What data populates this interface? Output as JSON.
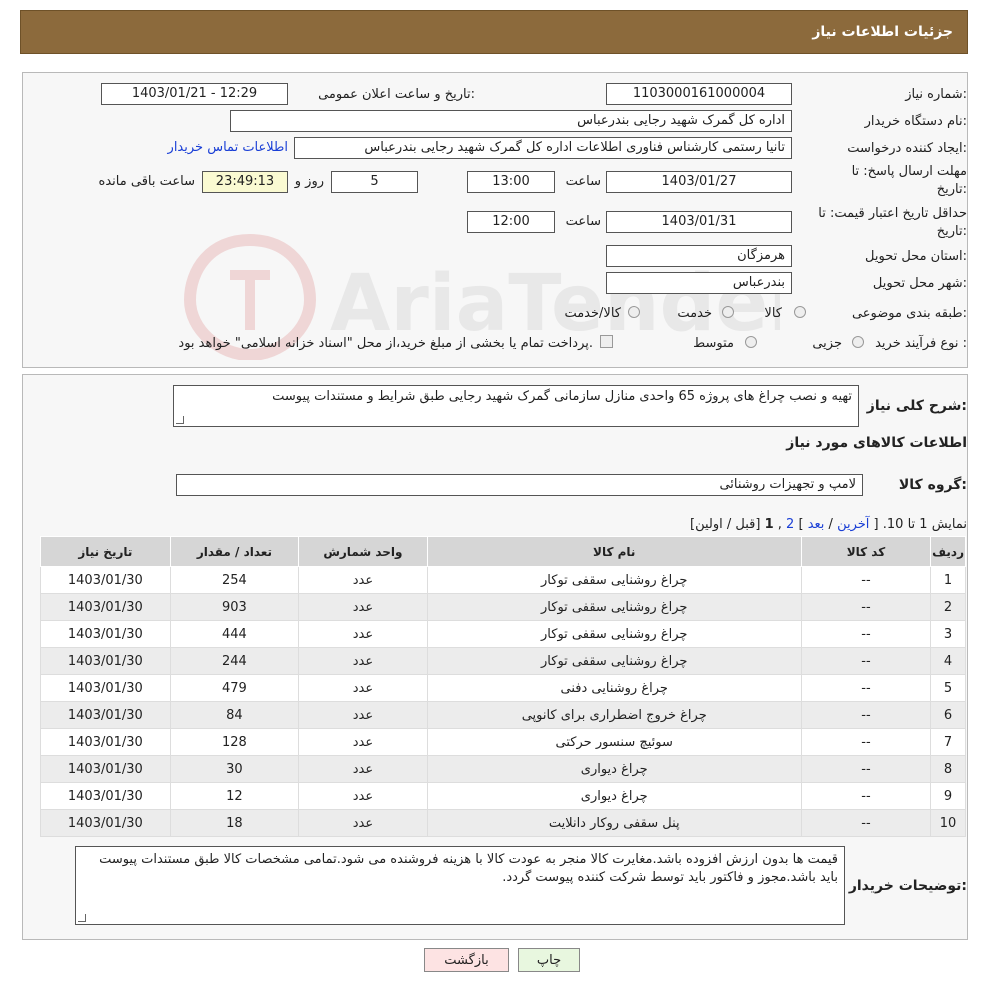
{
  "header": {
    "title": "جزئیات اطلاعات نیاز"
  },
  "info": {
    "need_number_label": "شماره نیاز:",
    "need_number": "1103000161000004",
    "announce_label": "تاریخ و ساعت اعلان عمومی:",
    "announce_value": "1403/01/21 - 12:29",
    "buyer_org_label": "نام دستگاه خریدار:",
    "buyer_org": "اداره کل گمرک شهید رجایی بندرعباس",
    "requester_label": "ایجاد کننده درخواست:",
    "requester": "تانیا رستمی کارشناس فناوری اطلاعات اداره کل گمرک شهید رجایی بندرعباس",
    "contact_link": "اطلاعات تماس خریدار",
    "deadline_label_1": "مهلت ارسال پاسخ: تا",
    "deadline_label_2": "تاریخ:",
    "deadline_date": "1403/01/27",
    "time_label": "ساعت",
    "deadline_time": "13:00",
    "days_value": "5",
    "days_label": "روز و",
    "remaining_time": "23:49:13",
    "remaining_label": "ساعت باقی مانده",
    "validity_label_1": "حداقل تاریخ اعتبار قیمت: تا",
    "validity_label_2": "تاریخ:",
    "validity_date": "1403/01/31",
    "validity_time": "12:00",
    "province_label": "استان محل تحویل:",
    "province": "هرمزگان",
    "city_label": "شهر محل تحویل:",
    "city": "بندرعباس",
    "category_label": "طبقه بندی موضوعی:",
    "category_options": [
      "کالا",
      "خدمت",
      "کالا/خدمت"
    ],
    "process_label": "نوع فرآیند خرید :",
    "process_options": [
      "جزیی",
      "متوسط"
    ],
    "process_note": "پرداخت تمام یا بخشی از مبلغ خرید،از محل \"اسناد خزانه اسلامی\" خواهد بود."
  },
  "details": {
    "description_label": "شرح کلی نیاز:",
    "description": "تهیه و نصب چراغ های پروژه 65 واحدی منازل سازمانی گمرک شهید رجایی طبق شرایط و مستندات پیوست",
    "goods_title": "اطلاعات کالاهای مورد نیاز",
    "group_label": "گروه کالا:",
    "group_value": "لامپ و تجهیزات روشنائی",
    "pager_text": "نمایش 1 تا 10.",
    "pager_last": "آخرین",
    "pager_next": "بعد",
    "pager_page2": "2",
    "pager_current": "1",
    "pager_prev": "قبل / اولین",
    "columns": [
      "ردیف",
      "کد کالا",
      "نام کالا",
      "واحد شمارش",
      "تعداد / مقدار",
      "تاریخ نیاز"
    ],
    "rows": [
      [
        "1",
        "--",
        "چراغ روشنایی سقفی توکار",
        "عدد",
        "254",
        "1403/01/30"
      ],
      [
        "2",
        "--",
        "چراغ روشنایی سقفی توکار",
        "عدد",
        "903",
        "1403/01/30"
      ],
      [
        "3",
        "--",
        "چراغ روشنایی سقفی توکار",
        "عدد",
        "444",
        "1403/01/30"
      ],
      [
        "4",
        "--",
        "چراغ روشنایی سقفی توکار",
        "عدد",
        "244",
        "1403/01/30"
      ],
      [
        "5",
        "--",
        "چراغ روشنایی دفنی",
        "عدد",
        "479",
        "1403/01/30"
      ],
      [
        "6",
        "--",
        "چراغ خروج اضطراری برای کانوپی",
        "عدد",
        "84",
        "1403/01/30"
      ],
      [
        "7",
        "--",
        "سوئیچ سنسور حرکتی",
        "عدد",
        "128",
        "1403/01/30"
      ],
      [
        "8",
        "--",
        "چراغ دیواری",
        "عدد",
        "30",
        "1403/01/30"
      ],
      [
        "9",
        "--",
        "چراغ دیواری",
        "عدد",
        "12",
        "1403/01/30"
      ],
      [
        "10",
        "--",
        "پنل سقفی روکار دانلایت",
        "عدد",
        "18",
        "1403/01/30"
      ]
    ],
    "buyer_notes_label": "توضیحات خریدار:",
    "buyer_notes": "قیمت ها بدون ارزش افزوده باشد.مغایرت کالا منجر به عودت کالا با هزینه فروشنده می شود.تمامی مشخصات کالا طبق مستندات پیوست باید باشد.مجوز و فاکتور باید توسط شرکت کننده پیوست گردد."
  },
  "buttons": {
    "print": "چاپ",
    "back": "بازگشت"
  },
  "watermark": "AriaTender.neT"
}
